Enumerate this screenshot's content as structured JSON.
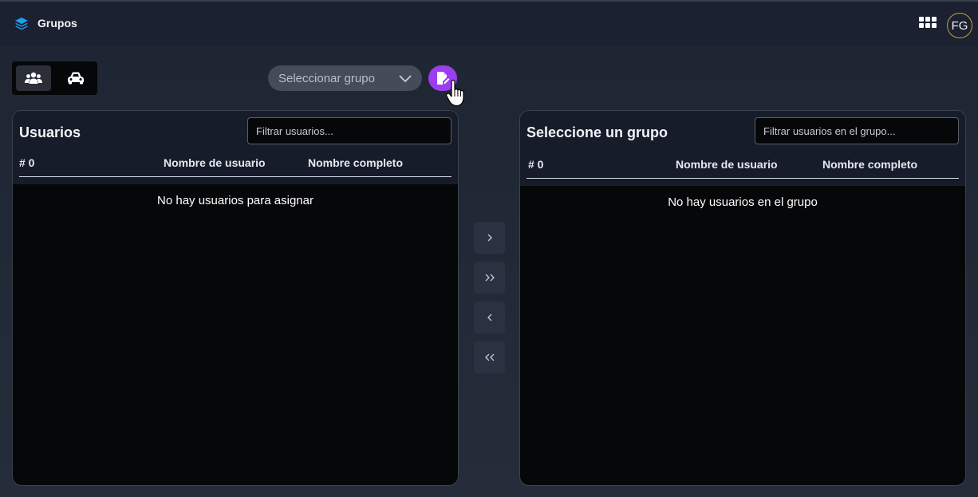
{
  "header": {
    "title": "Grupos",
    "logo_icon": "layers-icon",
    "apps_icon": "apps-grid-icon",
    "avatar_initials": "FG",
    "avatar_border_color": "#c9a227"
  },
  "toolbar": {
    "segments": [
      {
        "icon": "users-icon",
        "active": true
      },
      {
        "icon": "car-icon",
        "active": false
      }
    ],
    "group_select": {
      "value": "Seleccionar grupo",
      "icon": "chevron-down-icon"
    },
    "edit_button": {
      "icon": "edit-document-icon",
      "color": "#9b3df0"
    }
  },
  "available_panel": {
    "title": "Usuarios",
    "filter_placeholder": "Filtrar usuarios...",
    "columns": {
      "count": "# 0",
      "username": "Nombre de usuario",
      "fullname": "Nombre completo"
    },
    "empty_message": "No hay usuarios para asignar"
  },
  "group_panel": {
    "title": "Seleccione un grupo",
    "filter_placeholder": "Filtrar usuarios en el grupo...",
    "columns": {
      "count": "# 0",
      "username": "Nombre de usuario",
      "fullname": "Nombre completo"
    },
    "empty_message": "No hay usuarios en el grupo"
  },
  "transfer_buttons": [
    {
      "label": "›",
      "icon": "chevron-right-icon"
    },
    {
      "label": "»",
      "icon": "double-chevron-right-icon"
    },
    {
      "label": "‹",
      "icon": "chevron-left-icon"
    },
    {
      "label": "«",
      "icon": "double-chevron-left-icon"
    }
  ]
}
